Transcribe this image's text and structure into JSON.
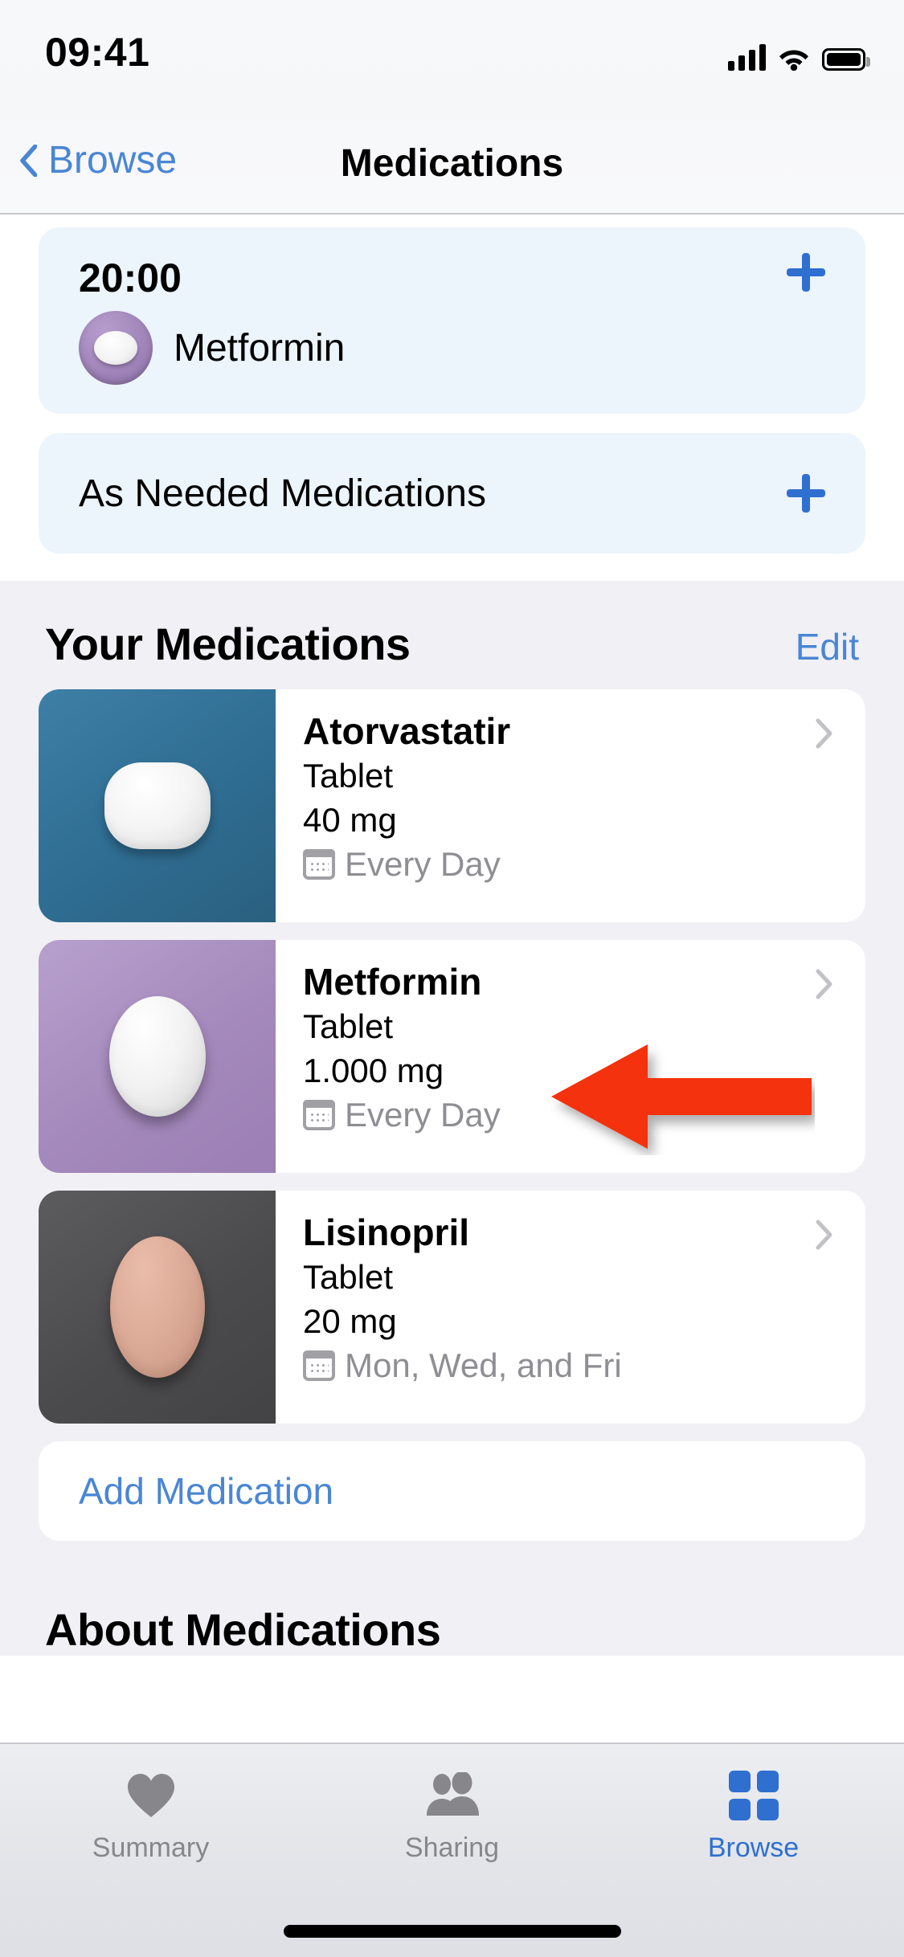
{
  "status_bar": {
    "time": "09:41",
    "cellular_icon": "cellular-signal-icon",
    "wifi_icon": "wifi-icon",
    "battery_icon": "battery-icon"
  },
  "nav_bar": {
    "back_label": "Browse",
    "back_icon": "chevron-left-icon",
    "title": "Medications"
  },
  "schedule": {
    "dose_card": {
      "time": "20:00",
      "medication": "Metformin",
      "pill_icon": "purple-round-pill-icon",
      "add_icon": "plus-icon"
    },
    "as_needed_card": {
      "label": "As Needed Medications",
      "add_icon": "plus-icon"
    }
  },
  "your_medications": {
    "title": "Your Medications",
    "edit_label": "Edit",
    "items": [
      {
        "name": "Atorvastatir",
        "form": "Tablet",
        "dose": "40 mg",
        "schedule": "Every Day",
        "calendar_icon": "calendar-icon",
        "chevron_icon": "chevron-right-icon",
        "thumb_color": "#2f6d92",
        "pill_shape": "capsule"
      },
      {
        "name": "Metformin",
        "form": "Tablet",
        "dose": "1.000 mg",
        "schedule": "Every Day",
        "calendar_icon": "calendar-icon",
        "chevron_icon": "chevron-right-icon",
        "thumb_color": "#a489bc",
        "pill_shape": "oval-white"
      },
      {
        "name": "Lisinopril",
        "form": "Tablet",
        "dose": "20 mg",
        "schedule": "Mon, Wed, and Fri",
        "calendar_icon": "calendar-icon",
        "chevron_icon": "chevron-right-icon",
        "thumb_color": "#4b4b4d",
        "pill_shape": "oval-pink"
      }
    ],
    "add_label": "Add Medication"
  },
  "about_section": {
    "title": "About Medications"
  },
  "annotation": {
    "type": "arrow-left",
    "color": "#F4300E",
    "points_at": "Metformin"
  },
  "tab_bar": {
    "tabs": [
      {
        "label": "Summary",
        "icon": "heart-icon",
        "active": false
      },
      {
        "label": "Sharing",
        "icon": "people-icon",
        "active": false
      },
      {
        "label": "Browse",
        "icon": "grid-squares-icon",
        "active": true
      }
    ]
  },
  "colors": {
    "accent_blue": "#2f6fd0",
    "link_blue": "#4a86d4",
    "card_blue": "#ecf4fc",
    "group_bg": "#f1f0f4",
    "secondary_text": "#8e8e93",
    "annotation_red": "#F4300E"
  }
}
